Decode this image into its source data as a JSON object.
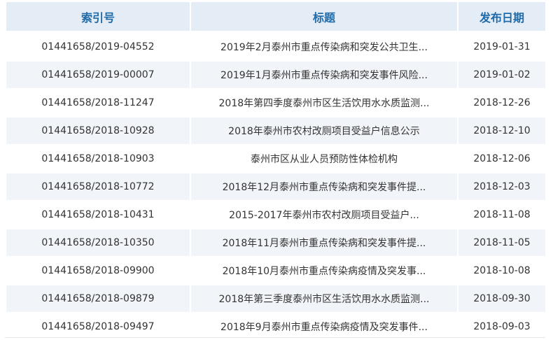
{
  "headers": {
    "index": "索引号",
    "title": "标题",
    "date": "发布日期"
  },
  "rows": [
    {
      "index": "01441658/2019-04552",
      "title": "2019年2月泰州市重点传染病和突发公共卫生...",
      "date": "2019-01-31"
    },
    {
      "index": "01441658/2019-00007",
      "title": "2019年1月泰州市重点传染病和突发事件风险...",
      "date": "2019-01-02"
    },
    {
      "index": "01441658/2018-11247",
      "title": "2018年第四季度泰州市区生活饮用水水质监测...",
      "date": "2018-12-26"
    },
    {
      "index": "01441658/2018-10928",
      "title": "2018年泰州市农村改厕项目受益户信息公示",
      "date": "2018-12-10"
    },
    {
      "index": "01441658/2018-10903",
      "title": "泰州市区从业人员预防性体检机构",
      "date": "2018-12-06"
    },
    {
      "index": "01441658/2018-10772",
      "title": "2018年12月泰州市重点传染病和突发事件提...",
      "date": "2018-12-03"
    },
    {
      "index": "01441658/2018-10431",
      "title": "2015-2017年泰州市农村改厕项目受益户...",
      "date": "2018-11-08"
    },
    {
      "index": "01441658/2018-10350",
      "title": "2018年11月泰州市重点传染病和突发事件提...",
      "date": "2018-11-05"
    },
    {
      "index": "01441658/2018-09900",
      "title": "2018年10月泰州市重点传染病疫情及突发事...",
      "date": "2018-10-08"
    },
    {
      "index": "01441658/2018-09879",
      "title": "2018年第三季度泰州市区生活饮用水水质监测...",
      "date": "2018-09-30"
    },
    {
      "index": "01441658/2018-09497",
      "title": "2018年9月泰州市重点传染病疫情及突发事件...",
      "date": "2018-09-03"
    }
  ]
}
